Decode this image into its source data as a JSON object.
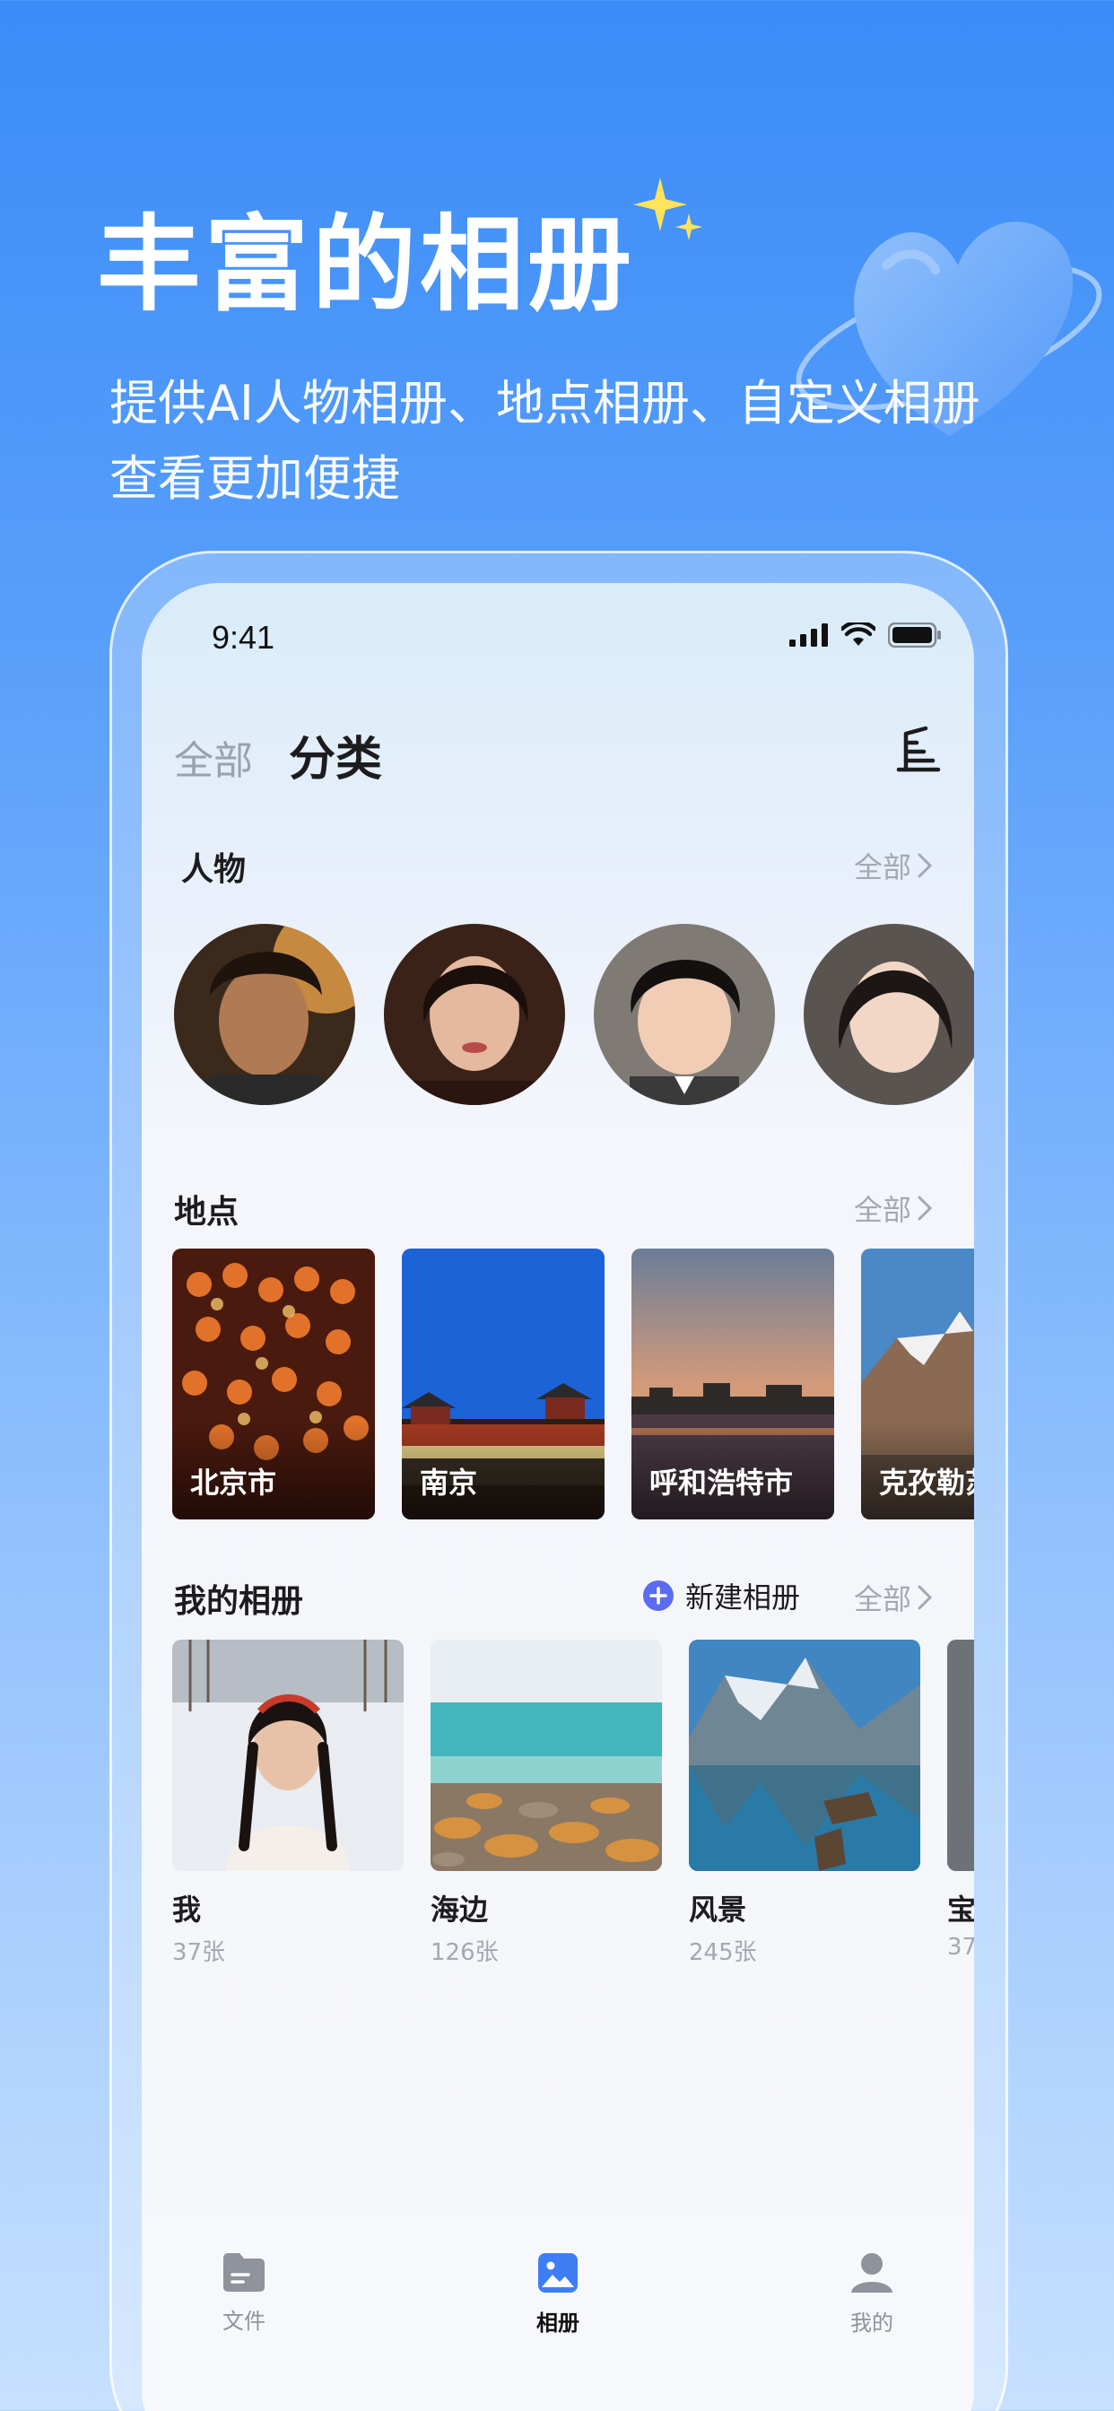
{
  "promo": {
    "title": "丰富的相册",
    "subtitle_line1": "提供AI人物相册、地点相册、自定义相册",
    "subtitle_line2": "查看更加便捷"
  },
  "status_bar": {
    "time": "9:41"
  },
  "tabs": {
    "all": "全部",
    "category": "分类"
  },
  "people": {
    "title": "人物",
    "see_all": "全部"
  },
  "places": {
    "title": "地点",
    "see_all": "全部",
    "items": [
      {
        "label": "北京市"
      },
      {
        "label": "南京"
      },
      {
        "label": "呼和浩特市"
      },
      {
        "label": "克孜勒苏"
      }
    ]
  },
  "albums": {
    "title": "我的相册",
    "new_label": "新建相册",
    "see_all": "全部",
    "items": [
      {
        "name": "我",
        "count": "37张"
      },
      {
        "name": "海边",
        "count": "126张"
      },
      {
        "name": "风景",
        "count": "245张"
      },
      {
        "name": "宝",
        "count": "37"
      }
    ]
  },
  "bottom_nav": {
    "files": "文件",
    "albums": "相册",
    "mine": "我的"
  },
  "colors": {
    "accent": "#3d7ef5",
    "nav_active": "#111111",
    "nav_inactive": "#8e939c",
    "plus_icon": "#5b6cf0"
  }
}
